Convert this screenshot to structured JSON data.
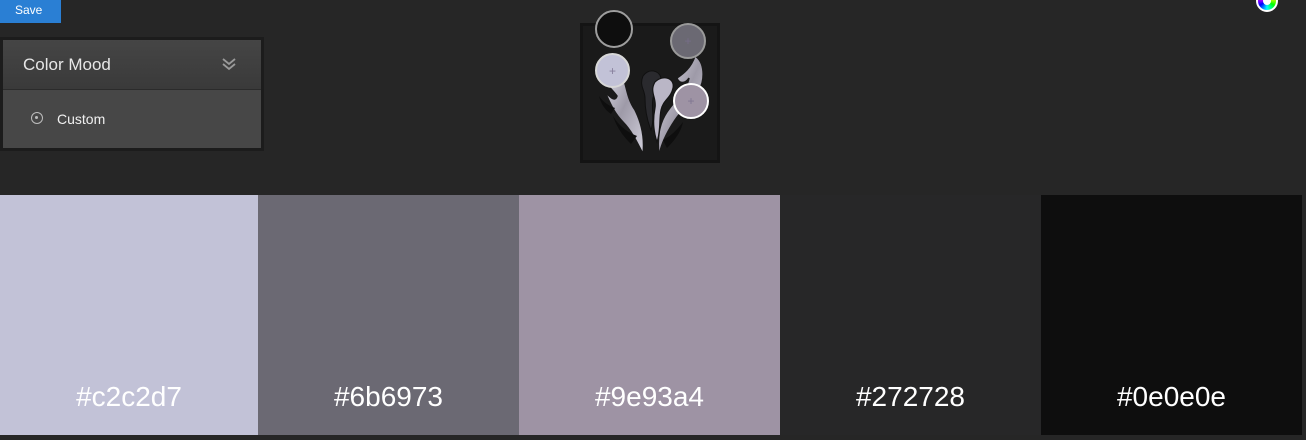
{
  "toolbar": {
    "save_label": "Save"
  },
  "panel": {
    "title": "Color Mood",
    "option_label": "Custom",
    "chevron_icon": "double-chevron-down-icon"
  },
  "color_wheel_icon": "color-wheel-icon",
  "image": {
    "description_icon": "dragon-emblem-image"
  },
  "swatches": [
    {
      "hex": "#c2c2d7",
      "color": "#c2c2d7"
    },
    {
      "hex": "#6b6973",
      "color": "#6b6973"
    },
    {
      "hex": "#9e93a4",
      "color": "#9e93a4"
    },
    {
      "hex": "#272728",
      "color": "#272728"
    },
    {
      "hex": "#0e0e0e",
      "color": "#0e0e0e"
    }
  ]
}
